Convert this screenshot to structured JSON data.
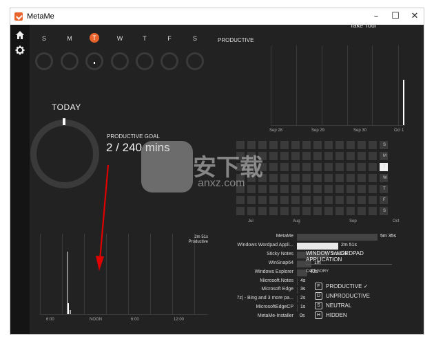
{
  "window": {
    "title": "MetaMe",
    "minimize": "–",
    "maximize": "☐",
    "close": "✕"
  },
  "sidebar": {
    "items": [
      {
        "icon": "home-icon"
      },
      {
        "icon": "gear-icon"
      }
    ]
  },
  "header": {
    "take_tour": "Take Tour"
  },
  "week": {
    "days": [
      "S",
      "M",
      "T",
      "W",
      "T",
      "F",
      "S"
    ],
    "today_index": 2
  },
  "today": {
    "label": "TODAY",
    "goal_title": "PRODUCTIVE GOAL",
    "goal_value": "2 / 240 mins",
    "goal_fraction": 0.0083
  },
  "productive_chart": {
    "label": "PRODUCTIVE",
    "dates": [
      "Sep 28",
      "Sep 29",
      "Sep 30",
      "Oct 1"
    ]
  },
  "heatmap": {
    "weekdays": [
      "S",
      "M",
      "T",
      "W",
      "T",
      "F",
      "S"
    ],
    "months": [
      "Jul",
      "Aug",
      "Sep",
      "Oct"
    ],
    "highlight": {
      "week": 13,
      "day": 2
    }
  },
  "timeline": {
    "ticks": [
      "6:00",
      "NOON",
      "6:00",
      "12:00"
    ],
    "total": "2m 51s",
    "category": "Productive"
  },
  "apps": [
    {
      "name": "MetaMe",
      "duration": "5m 35s",
      "seconds": 335,
      "active": false
    },
    {
      "name": "Windows Wordpad Appli...",
      "duration": "2m 51s",
      "seconds": 171,
      "active": true
    },
    {
      "name": "Sticky Notes",
      "duration": "2m 13s",
      "seconds": 133,
      "active": false
    },
    {
      "name": "WinSnap64",
      "duration": "1m",
      "seconds": 60,
      "active": false
    },
    {
      "name": "Windows Explorer",
      "duration": "42s",
      "seconds": 42,
      "active": false
    },
    {
      "name": "Microsoft.Notes",
      "duration": "4s",
      "seconds": 4,
      "active": false
    },
    {
      "name": "Microsoft Edge",
      "duration": "3s",
      "seconds": 3,
      "active": false
    },
    {
      "name": "7z| - Bing and 3 more pa...",
      "duration": "2s",
      "seconds": 2,
      "active": false
    },
    {
      "name": "MicrosoftEdgeCP",
      "duration": "1s",
      "seconds": 1,
      "active": false
    },
    {
      "name": "MetaMe-Installer",
      "duration": "0s",
      "seconds": 0,
      "active": false
    }
  ],
  "detail": {
    "title": "WINDOWS WORDPAD APPLICATION",
    "category_label": "CATEGORY",
    "categories": [
      {
        "key": "F",
        "name": "PRODUCTIVE ✓"
      },
      {
        "key": "D",
        "name": "UNPRODUCTIVE"
      },
      {
        "key": "S",
        "name": "NEUTRAL"
      },
      {
        "key": "H",
        "name": "HIDDEN"
      }
    ]
  },
  "watermark": {
    "text": "安下载",
    "sub": "anxz.com"
  },
  "colors": {
    "accent": "#e8642c",
    "arrow": "#e00000",
    "background": "#222222"
  }
}
